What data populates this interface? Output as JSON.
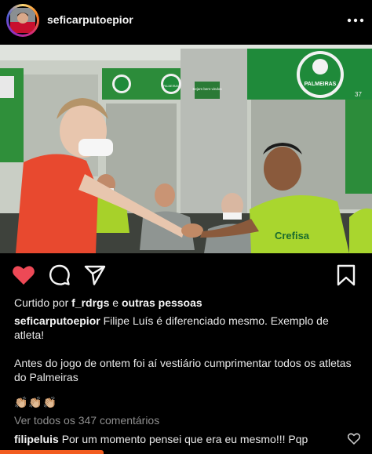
{
  "header": {
    "username": "seficarputoepior",
    "avatar_icon": "profile-avatar",
    "more_icon": "more-options-icon"
  },
  "photo": {
    "signs": {
      "brand_left": "PALMEIRAS",
      "brand_right": "PALMEIRAS",
      "wall_note": "Sejam bem-vindos",
      "shirt_sponsor": "Crefisa",
      "shirt_number": "37"
    }
  },
  "actions": {
    "like_icon": "heart-filled-icon",
    "comment_icon": "comment-icon",
    "share_icon": "send-icon",
    "save_icon": "bookmark-icon"
  },
  "likes": {
    "prefix": "Curtido por",
    "user": "f_rdrgs",
    "connector": "e",
    "others": "outras pessoas"
  },
  "caption": {
    "username": "seficarputoepior",
    "line1": "Filipe Luís é diferenciado mesmo. Exemplo de atleta!",
    "line2": "Antes do jogo de ontem foi aí vestiário cumprimentar todos os atletas do Palmeiras",
    "emojis": "👏🏼👏🏼👏🏼"
  },
  "comments": {
    "view_all": "Ver todos os 347 comentários",
    "top": {
      "username": "filipeluis",
      "text": "Por um momento pensei que era eu mesmo!!! Pqp"
    }
  },
  "colors": {
    "background": "#000000",
    "like_red": "#ed4956",
    "muted_text": "#8e8e8e",
    "accent_bar": "#f25c1f"
  }
}
